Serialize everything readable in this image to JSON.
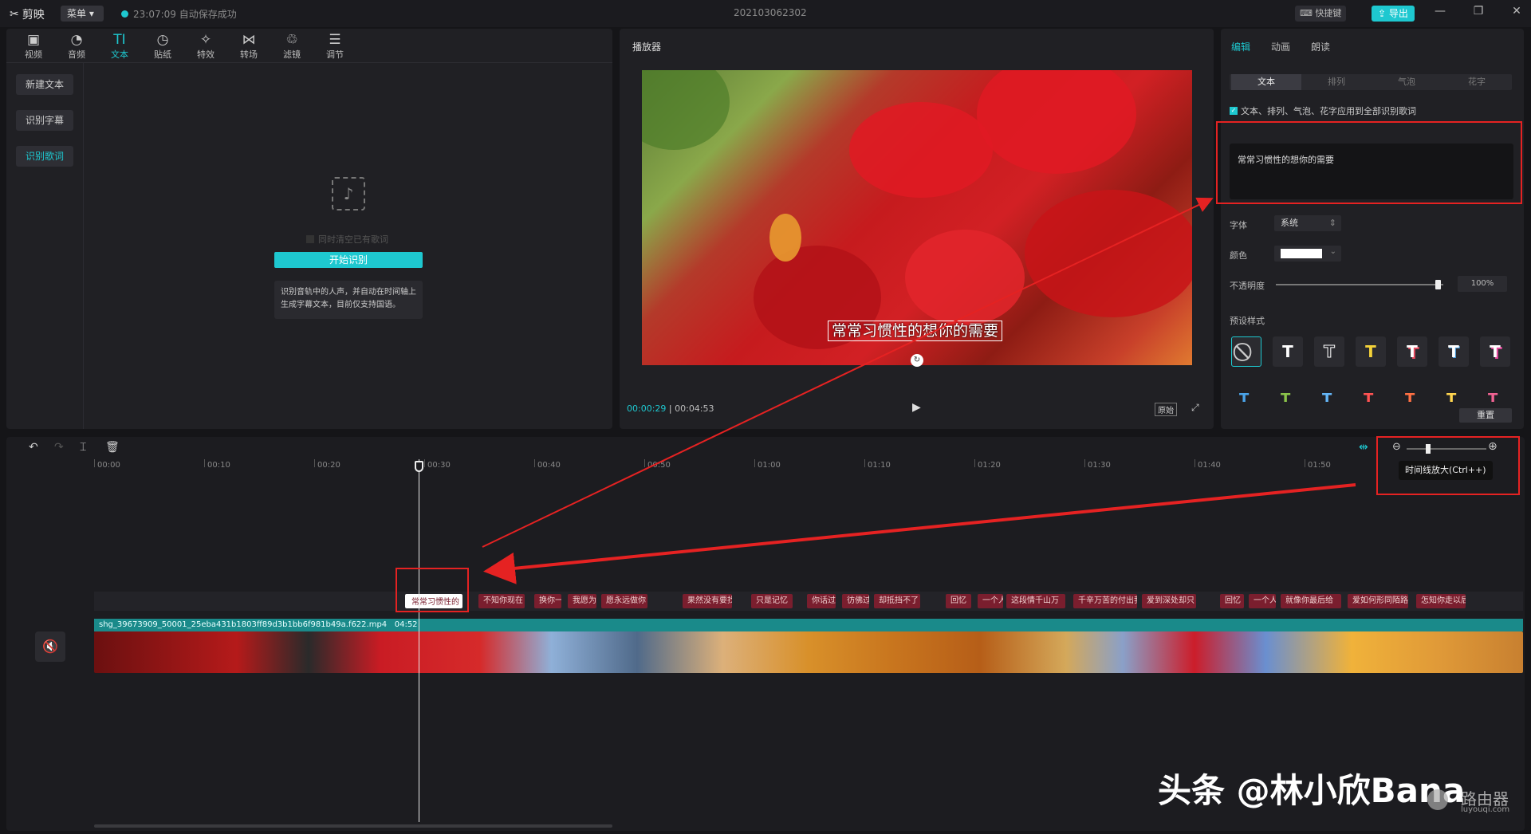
{
  "app": {
    "name": "剪映",
    "menu_label": "菜单",
    "autosave": "23:07:09 自动保存成功",
    "project_name": "202103062302",
    "shortcut_label": "快捷键",
    "export_label": "导出"
  },
  "toolbar": {
    "items": [
      {
        "label": "视频",
        "icon": "video-icon"
      },
      {
        "label": "音频",
        "icon": "audio-icon"
      },
      {
        "label": "文本",
        "icon": "text-icon"
      },
      {
        "label": "贴纸",
        "icon": "sticker-icon"
      },
      {
        "label": "特效",
        "icon": "effects-icon"
      },
      {
        "label": "转场",
        "icon": "transition-icon"
      },
      {
        "label": "滤镜",
        "icon": "filter-icon"
      },
      {
        "label": "调节",
        "icon": "adjust-icon"
      }
    ]
  },
  "left_panel": {
    "buttons": [
      "新建文本",
      "识别字幕",
      "识别歌词"
    ],
    "checkbox_label": "同时清空已有歌词",
    "start_button": "开始识别",
    "description": "识别音轨中的人声，并自动在时间轴上生成字幕文本，目前仅支持国语。"
  },
  "player": {
    "title": "播放器",
    "current_time": "00:00:29",
    "total_time": "00:04:53",
    "subtitle": "常常习惯性的想你的需要",
    "ratio_label": "原始"
  },
  "right_panel": {
    "tabs": [
      "编辑",
      "动画",
      "朗读"
    ],
    "segments": [
      "文本",
      "排列",
      "气泡",
      "花字"
    ],
    "apply_all_label": "文本、排列、气泡、花字应用到全部识别歌词",
    "text_value": "常常习惯性的想你的需要",
    "font_label": "字体",
    "font_value": "系统",
    "color_label": "颜色",
    "opacity_label": "不透明度",
    "opacity_value": "100%",
    "preset_label": "预设样式",
    "reset_label": "重置",
    "opacity": 1.0
  },
  "timeline": {
    "ticks": [
      "00:00",
      "00:10",
      "00:20",
      "00:30",
      "00:40",
      "00:50",
      "01:00",
      "01:10",
      "01:20",
      "01:30",
      "01:40",
      "01:50"
    ],
    "zoom_tooltip": "时间线放大(Ctrl++)",
    "lyric_clips": [
      "常常习惯性的",
      "不知你现在",
      "换你一",
      "我愿为",
      "愿永远做你",
      "果然没有要找",
      "只是记忆",
      "你话过",
      "彷佛过",
      "却抵挡不了",
      "回忆",
      "一个人",
      "这段情千山万",
      "千辛万苦的付出我",
      "爱到深处却只",
      "回忆",
      "一个人",
      "就像你最后给",
      "爱如何形同陌路你",
      "怎知你走以后"
    ],
    "video_file": "shg_39673909_50001_25eba431b1803ff89d3b1bb6f981b49a.f622.mp4",
    "video_duration": "04:52"
  },
  "watermark": "头条 @林小欣Bana",
  "site_watermark": {
    "name": "路由器",
    "url": "luyouqi.com"
  }
}
